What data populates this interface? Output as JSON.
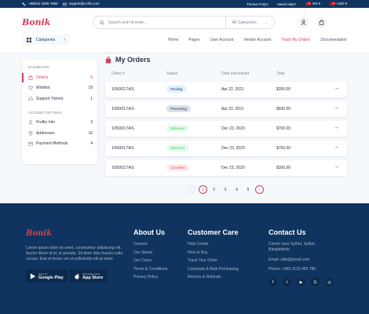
{
  "topbar": {
    "phone": "+88012 3456 7894",
    "email": "support@ui-lib.com",
    "faq": "Theme FAQ's",
    "help": "Need Help?",
    "language": "EN",
    "currency": "USD"
  },
  "header": {
    "logo": "Bonik",
    "search_placeholder": "Search and hit enter...",
    "category_select": "All Categories",
    "categories_button": "Categories",
    "cart_count": ""
  },
  "nav": [
    "Home",
    "Pages",
    "User Account",
    "Vendor Account",
    "Track My Orders",
    "Documentation"
  ],
  "sidebar": {
    "dashboard_label": "DASHBOARD",
    "dashboard_items": [
      {
        "label": "Orders",
        "count": "5"
      },
      {
        "label": "Wishlist",
        "count": "19"
      },
      {
        "label": "Support Tickets",
        "count": "1"
      }
    ],
    "settings_label": "ACCOUNT SETTINGS",
    "settings_items": [
      {
        "label": "Profile Info",
        "count": "3"
      },
      {
        "label": "Addresses",
        "count": "16"
      },
      {
        "label": "Payment Methods",
        "count": "4"
      }
    ]
  },
  "page": {
    "title": "My Orders"
  },
  "table": {
    "headers": [
      "Order #",
      "Status",
      "Date purchased",
      "Total"
    ],
    "rows": [
      {
        "order": "1050017AS",
        "status": "Pending",
        "date": "Apr 22, 2021",
        "total": "$350.00"
      },
      {
        "order": "1050017AS",
        "status": "Processing",
        "date": "Apr 22, 2021",
        "total": "$500.00"
      },
      {
        "order": "1050017AS",
        "status": "Delivered",
        "date": "Dec 23, 2020",
        "total": "$700.00"
      },
      {
        "order": "1050017AS",
        "status": "Delivered",
        "date": "Dec 23, 2020",
        "total": "$700.00"
      },
      {
        "order": "1050017AS",
        "status": "Cancelled",
        "date": "Dec 15, 2020",
        "total": "$300.00"
      }
    ]
  },
  "pagination": {
    "pages": [
      "1",
      "2",
      "3",
      "4",
      "5"
    ],
    "current": "1"
  },
  "footer": {
    "logo": "Bonik",
    "description": "Lorem ipsum dolor sit amet, consectetur adipiscing elit. Auctor libero id et, in gravida. Sit diam duis mauris nulla cursus. Erat et lectus vel ut sollicitudin elit at amet.",
    "google_play": {
      "small": "Get it on",
      "big": "Google Play"
    },
    "app_store": {
      "small": "Download on the",
      "big": "App Store"
    },
    "about": {
      "title": "About Us",
      "links": [
        "Careers",
        "Our Stores",
        "Our Cares",
        "Terms & Conditions",
        "Privacy Policy"
      ]
    },
    "care": {
      "title": "Customer Care",
      "links": [
        "Help Center",
        "How to Buy",
        "Track Your Order",
        "Corporate & Bulk Purchasing",
        "Returns & Refunds"
      ]
    },
    "contact": {
      "title": "Contact Us",
      "lines": [
        "Corner view Sylhet, Sylhet,",
        "Bangladesh.",
        "Email: uilib@gmail.com",
        "Phone: +880 1123 456 780"
      ]
    }
  }
}
